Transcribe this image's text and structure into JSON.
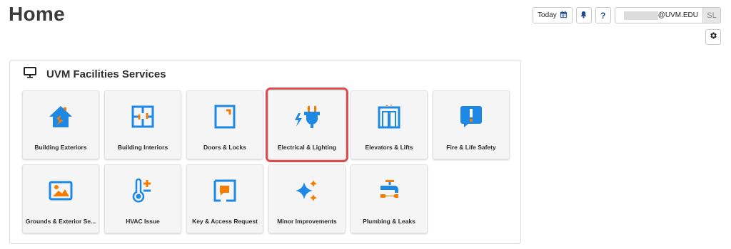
{
  "page": {
    "title": "Home"
  },
  "topbar": {
    "today_label": "Today",
    "help_label": "?",
    "user_email": "@UVM.EDU",
    "user_initials": "SL"
  },
  "colors": {
    "accent_blue": "#1e88e5",
    "accent_orange": "#f57c00",
    "highlight_red": "#e0494a"
  },
  "card": {
    "title": "UVM Facilities Services",
    "tiles": [
      {
        "label": "Building Exteriors",
        "icon": "house-icon",
        "selected": false
      },
      {
        "label": "Building Interiors",
        "icon": "floorplan-icon",
        "selected": false
      },
      {
        "label": "Doors & Locks",
        "icon": "door-icon",
        "selected": false
      },
      {
        "label": "Electrical & Lighting",
        "icon": "plug-icon",
        "selected": true
      },
      {
        "label": "Elevators & Lifts",
        "icon": "elevator-icon",
        "selected": false
      },
      {
        "label": "Fire & Life Safety",
        "icon": "alert-icon",
        "selected": false
      },
      {
        "label": "Grounds & Exterior Se...",
        "icon": "landscape-icon",
        "selected": false
      },
      {
        "label": "HVAC Issue",
        "icon": "thermometer-icon",
        "selected": false
      },
      {
        "label": "Key & Access Request",
        "icon": "key-access-icon",
        "selected": false
      },
      {
        "label": "Minor Improvements",
        "icon": "sparkle-icon",
        "selected": false
      },
      {
        "label": "Plumbing & Leaks",
        "icon": "faucet-icon",
        "selected": false
      }
    ]
  }
}
